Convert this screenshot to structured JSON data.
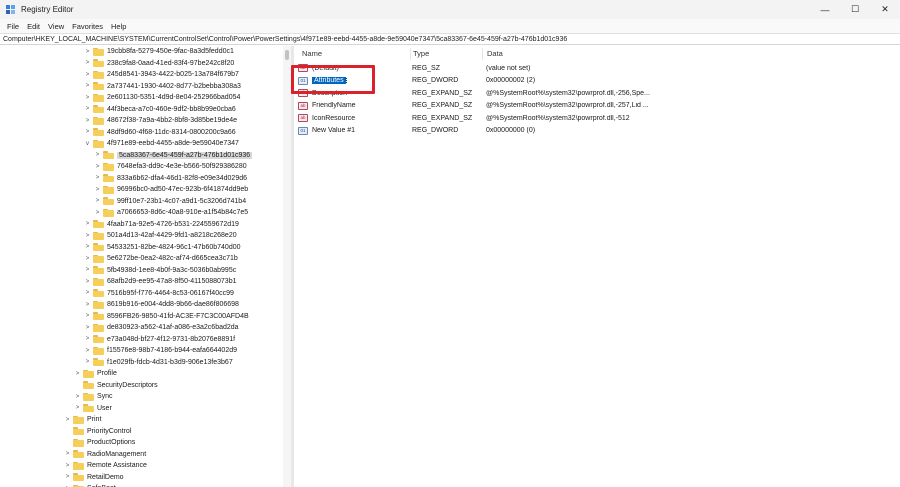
{
  "window": {
    "title": "Registry Editor",
    "minimize": "—",
    "maximize": "☐",
    "close": "✕"
  },
  "menu": [
    "File",
    "Edit",
    "View",
    "Favorites",
    "Help"
  ],
  "address": "Computer\\HKEY_LOCAL_MACHINE\\SYSTEM\\CurrentControlSet\\Control\\Power\\PowerSettings\\4f971e89-eebd-4455-a8de-9e59040e7347\\5ca83367-6e45-459f-a27b-476b1d01c936",
  "tree": [
    {
      "label": "19cbb8fa-5279-450e-9fac-8a3d5fedd0c1",
      "depth": 2,
      "chev": ">"
    },
    {
      "label": "238c9fa8-0aad-41ed-83f4-97be242c8f20",
      "depth": 2,
      "chev": ">"
    },
    {
      "label": "245d8541-3943-4422-b025-13a784f679b7",
      "depth": 2,
      "chev": ">"
    },
    {
      "label": "2a737441-1930-4402-8d77-b2bebba308a3",
      "depth": 2,
      "chev": ">"
    },
    {
      "label": "2e601130-5351-4d9d-8e04-252966bad054",
      "depth": 2,
      "chev": ">"
    },
    {
      "label": "44f3beca-a7c0-460e-9df2-bb8b99e0cba6",
      "depth": 2,
      "chev": ">"
    },
    {
      "label": "48672f38-7a9a-4bb2-8bf8-3d85be19de4e",
      "depth": 2,
      "chev": ">"
    },
    {
      "label": "48df9d60-4f68-11dc-8314-0800200c9a66",
      "depth": 2,
      "chev": ">"
    },
    {
      "label": "4f971e89-eebd-4455-a8de-9e59040e7347",
      "depth": 2,
      "chev": "v"
    },
    {
      "label": "5ca83367-6e45-459f-a27b-476b1d01c936",
      "depth": 3,
      "chev": ">",
      "selected": true
    },
    {
      "label": "7648efa3-dd9c-4e3e-b566-50f929386280",
      "depth": 3,
      "chev": ">"
    },
    {
      "label": "833a6b62-dfa4-46d1-82f8-e09e34d029d6",
      "depth": 3,
      "chev": ">"
    },
    {
      "label": "96996bc0-ad50-47ec-923b-6f41874dd9eb",
      "depth": 3,
      "chev": ">"
    },
    {
      "label": "99ff10e7-23b1-4c07-a9d1-5c3206d741b4",
      "depth": 3,
      "chev": ">"
    },
    {
      "label": "a7066653-8d6c-40a8-910e-a1f54b84c7e5",
      "depth": 3,
      "chev": ">"
    },
    {
      "label": "4faab71a-92e5-4726-b531-224559672d19",
      "depth": 2,
      "chev": ">"
    },
    {
      "label": "501a4d13-42af-4429-9fd1-a8218c268e20",
      "depth": 2,
      "chev": ">"
    },
    {
      "label": "54533251-82be-4824-96c1-47b60b740d00",
      "depth": 2,
      "chev": ">"
    },
    {
      "label": "5e6272be-0ea2-482c-af74-d665cea3c71b",
      "depth": 2,
      "chev": ">"
    },
    {
      "label": "5fb4938d-1ee8-4b0f-9a3c-5036b0ab995c",
      "depth": 2,
      "chev": ">"
    },
    {
      "label": "68afb2d9-ee95-47a8-8f50-4115088073b1",
      "depth": 2,
      "chev": ">"
    },
    {
      "label": "7516b95f-f776-4464-8c53-06167f40cc99",
      "depth": 2,
      "chev": ">"
    },
    {
      "label": "8619b916-e004-4dd8-9b66-dae86f806698",
      "depth": 2,
      "chev": ">"
    },
    {
      "label": "8596FB26-9850-41fd-AC3E-F7C3C00AFD4B",
      "depth": 2,
      "chev": ">"
    },
    {
      "label": "de830923-a562-41af-a086-e3a2c6bad2da",
      "depth": 2,
      "chev": ">"
    },
    {
      "label": "e73a048d-bf27-4f12-9731-8b2076e8891f",
      "depth": 2,
      "chev": ">"
    },
    {
      "label": "f15576e8-98b7-4186-b944-eafa664402d9",
      "depth": 2,
      "chev": ">"
    },
    {
      "label": "f1e029fb-fdcb-4d31-b3d9-906e13fe3b67",
      "depth": 2,
      "chev": ">"
    },
    {
      "label": "Profile",
      "depth": 1,
      "chev": ">"
    },
    {
      "label": "SecurityDescriptors",
      "depth": 1,
      "chev": ""
    },
    {
      "label": "Sync",
      "depth": 1,
      "chev": ">"
    },
    {
      "label": "User",
      "depth": 1,
      "chev": ">"
    },
    {
      "label": "Print",
      "depth": 0,
      "chev": ">"
    },
    {
      "label": "PriorityControl",
      "depth": 0,
      "chev": ""
    },
    {
      "label": "ProductOptions",
      "depth": 0,
      "chev": ""
    },
    {
      "label": "RadioManagement",
      "depth": 0,
      "chev": ">"
    },
    {
      "label": "Remote Assistance",
      "depth": 0,
      "chev": ">"
    },
    {
      "label": "RetailDemo",
      "depth": 0,
      "chev": ">"
    },
    {
      "label": "SafeBoot",
      "depth": 0,
      "chev": ">"
    }
  ],
  "columns": {
    "name": "Name",
    "type": "Type",
    "data": "Data"
  },
  "values": [
    {
      "name": "(Default)",
      "type": "REG_SZ",
      "data": "(value not set)",
      "icon": "ab"
    },
    {
      "name": "Attributes",
      "type": "REG_DWORD",
      "data": "0x00000002 (2)",
      "icon": "01",
      "selected": true
    },
    {
      "name": "Description",
      "type": "REG_EXPAND_SZ",
      "data": "@%SystemRoot%\\system32\\powrprof.dll,-256,Spe...",
      "icon": "ab"
    },
    {
      "name": "FriendlyName",
      "type": "REG_EXPAND_SZ",
      "data": "@%SystemRoot%\\system32\\powrprof.dll,-257,Lid ...",
      "icon": "ab"
    },
    {
      "name": "IconResource",
      "type": "REG_EXPAND_SZ",
      "data": "@%SystemRoot%\\system32\\powrprof.dll,-512",
      "icon": "ab"
    },
    {
      "name": "New Value #1",
      "type": "REG_DWORD",
      "data": "0x00000000 (0)",
      "icon": "01"
    }
  ],
  "highlight_color": "#d9222a",
  "selection_color": "#0067c0"
}
